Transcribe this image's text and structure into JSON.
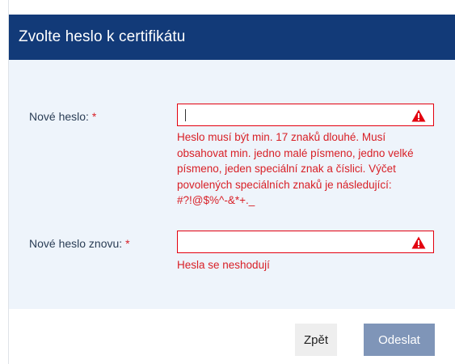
{
  "dialog": {
    "title": "Zvolte heslo k certifikátu"
  },
  "fields": {
    "new_password": {
      "label": "Nové heslo:",
      "required_mark": "*",
      "value": "",
      "error": "Heslo musí být min. 17 znaků dlouhé. Musí obsahovat min. jedno malé písmeno, jedno velké písmeno, jeden speciální znak a číslici. Výčet povolených speciálních znaků je následující: #?!@$%^-&*+._"
    },
    "new_password_repeat": {
      "label": "Nové heslo znovu:",
      "required_mark": "*",
      "value": "",
      "error": "Hesla se neshodují"
    }
  },
  "buttons": {
    "back": "Zpět",
    "submit": "Odeslat"
  },
  "icons": {
    "field_warning": "warning-triangle-icon"
  },
  "colors": {
    "header_bg": "#123a78",
    "error": "#d81f26",
    "body_bg": "#eef4fb",
    "submit_bg": "#7f95b8"
  }
}
